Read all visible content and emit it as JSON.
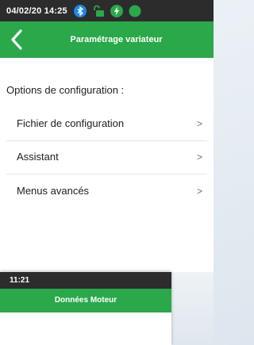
{
  "colors": {
    "status_bar": "#2c2c2c",
    "app_bar": "#2aa84a",
    "bluetooth": "#1e88e5",
    "lock": "#2aa84a",
    "charge": "#2aa84a",
    "status_dot": "#2aa84a"
  },
  "status_bar": {
    "text": "04/02/20  14:25",
    "icons": [
      "bluetooth-icon",
      "unlock-icon",
      "lightning-icon",
      "status-dot-icon"
    ]
  },
  "app_bar": {
    "back_icon": "chevron-left-icon",
    "title": "Paramétrage variateur"
  },
  "content": {
    "section_title": "Options de configuration :",
    "items": [
      {
        "label": "Fichier de configuration",
        "chevron": ">"
      },
      {
        "label": "Assistant",
        "chevron": ">"
      },
      {
        "label": "Menus avancés",
        "chevron": ">"
      }
    ]
  },
  "background_screen": {
    "status_text": "11:21",
    "title": "Données Moteur"
  }
}
